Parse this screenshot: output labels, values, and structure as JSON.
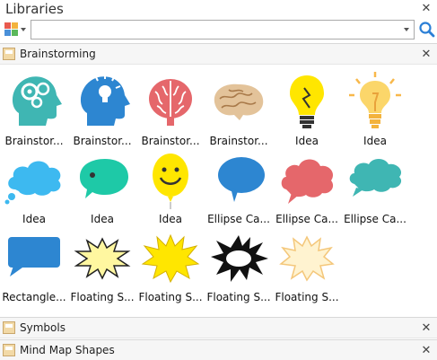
{
  "panel": {
    "title": "Libraries"
  },
  "search": {
    "value": "",
    "placeholder": ""
  },
  "sections": [
    {
      "label": "Brainstorming",
      "expanded": true
    },
    {
      "label": "Symbols",
      "expanded": false
    },
    {
      "label": "Mind Map Shapes",
      "expanded": false
    }
  ],
  "shapes": [
    {
      "label": "Brainstor...",
      "icon": "head-gears-icon"
    },
    {
      "label": "Brainstor...",
      "icon": "head-lightbulb-icon"
    },
    {
      "label": "Brainstor...",
      "icon": "brain-red-icon"
    },
    {
      "label": "Brainstor...",
      "icon": "brain-tan-icon"
    },
    {
      "label": "Idea",
      "icon": "lightbulb-yellow-icon"
    },
    {
      "label": "Idea",
      "icon": "lightbulb-glow-icon"
    },
    {
      "label": "Idea",
      "icon": "cloud-blue-icon"
    },
    {
      "label": "Idea",
      "icon": "speech-bubble-teal-icon"
    },
    {
      "label": "Idea",
      "icon": "smiley-balloon-icon"
    },
    {
      "label": "Ellipse Ca...",
      "icon": "ellipse-callout-blue-icon"
    },
    {
      "label": "Ellipse Ca...",
      "icon": "ellipse-callout-red-icon"
    },
    {
      "label": "Ellipse Ca...",
      "icon": "ellipse-callout-teal-icon"
    },
    {
      "label": "Rectangle...",
      "icon": "rectangle-callout-icon"
    },
    {
      "label": "Floating S...",
      "icon": "starburst-yellow-outline-icon"
    },
    {
      "label": "Floating S...",
      "icon": "starburst-yellow-icon"
    },
    {
      "label": "Floating S...",
      "icon": "starburst-black-icon"
    },
    {
      "label": "Floating S...",
      "icon": "starburst-light-icon"
    }
  ],
  "colors": {
    "teal": "#3fb6b3",
    "blue": "#2d86d1",
    "red": "#e5676b",
    "tan": "#e3c39a",
    "yellow": "#ffe600",
    "header_bg": "#f6f6f6"
  }
}
